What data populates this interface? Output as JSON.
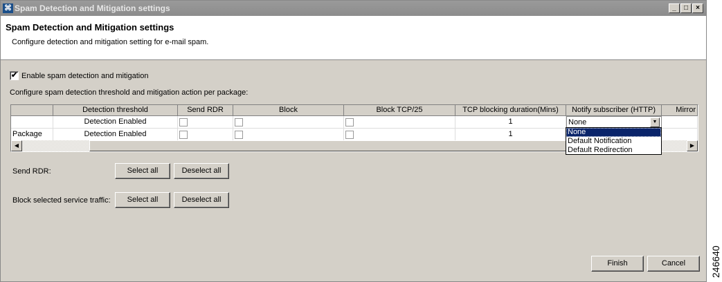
{
  "window": {
    "title": "Spam Detection and Mitigation settings",
    "controls": [
      "_",
      "□",
      "×"
    ]
  },
  "header": {
    "title": "Spam Detection and Mitigation settings",
    "description": "Configure detection and mitigation setting for e-mail spam."
  },
  "enable": {
    "label": "Enable spam detection and mitigation",
    "checked": true
  },
  "table_caption": "Configure spam detection threshold and mitigation action per package:",
  "table": {
    "columns": [
      "",
      "Detection threshold",
      "Send RDR",
      "Block",
      "Block TCP/25",
      "TCP blocking duration(Mins)",
      "Notify subscriber (HTTP)",
      "Mirror"
    ],
    "rows": [
      {
        "name": "",
        "threshold": "Detection Enabled",
        "duration": "1",
        "notify": "None"
      },
      {
        "name": "Package",
        "threshold": "Detection Enabled",
        "duration": "1",
        "notify": ""
      }
    ]
  },
  "dropdown": {
    "options": [
      "None",
      "Default Notification",
      "Default Redirection"
    ],
    "selected": "None"
  },
  "send_rdr": {
    "label": "Send RDR:",
    "select_all": "Select all",
    "deselect_all": "Deselect all"
  },
  "block_traffic": {
    "label": "Block selected service traffic:",
    "select_all": "Select all",
    "deselect_all": "Deselect all"
  },
  "footer": {
    "finish": "Finish",
    "cancel": "Cancel"
  },
  "figure_id": "246640"
}
